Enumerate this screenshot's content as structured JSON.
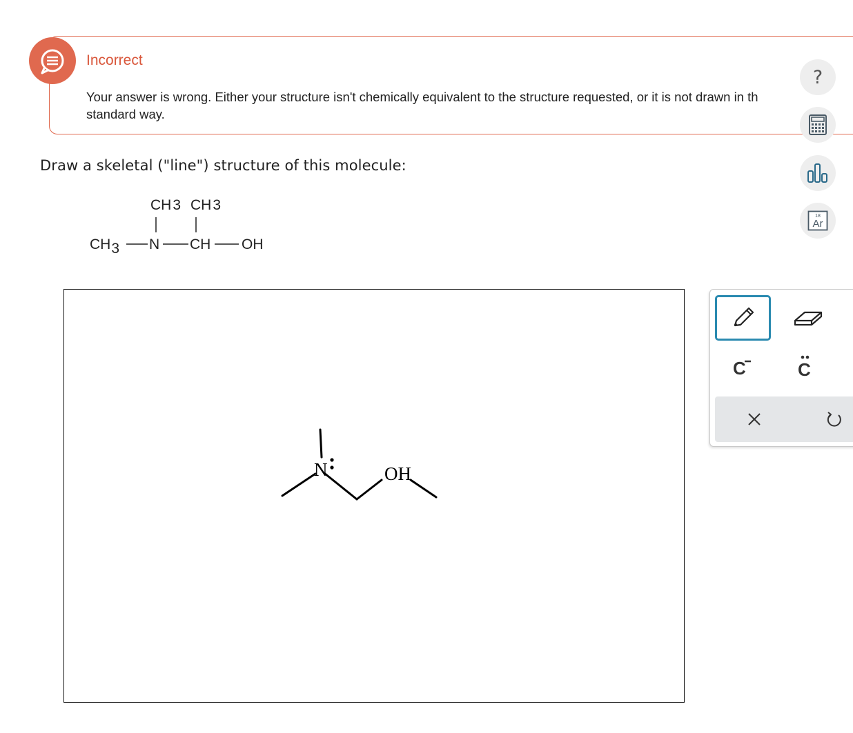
{
  "feedback": {
    "title": "Incorrect",
    "message_line1": "Your answer is wrong. Either your structure isn't chemically equivalent to the structure requested, or it is not drawn in th",
    "message_line2": "standard way.",
    "accent_color": "#e0694f"
  },
  "side_tools": {
    "help_label": "?",
    "calculator_icon": "calculator-icon",
    "chart_icon": "bar-chart-icon",
    "periodic_label": "Ar",
    "periodic_number": "18"
  },
  "question": {
    "text": "Draw a skeletal (\"line\") structure of this molecule:"
  },
  "formula": {
    "top_left": "CH",
    "top_left_sub": "3",
    "top_right": "CH",
    "top_right_sub": "3",
    "left": "CH",
    "left_sub": "3",
    "n_atom": "N",
    "ch_atom": "CH",
    "oh_group": "OH"
  },
  "canvas": {
    "n_label": "N",
    "oh_label": "OH"
  },
  "palette": {
    "pencil_icon": "pencil-icon",
    "eraser_icon": "eraser-icon",
    "charge_label": "C",
    "charge_sign": "−",
    "lonepair_label": "C",
    "clear_label": "×",
    "undo_icon": "undo-icon",
    "selected_color": "#2a8ab0"
  }
}
